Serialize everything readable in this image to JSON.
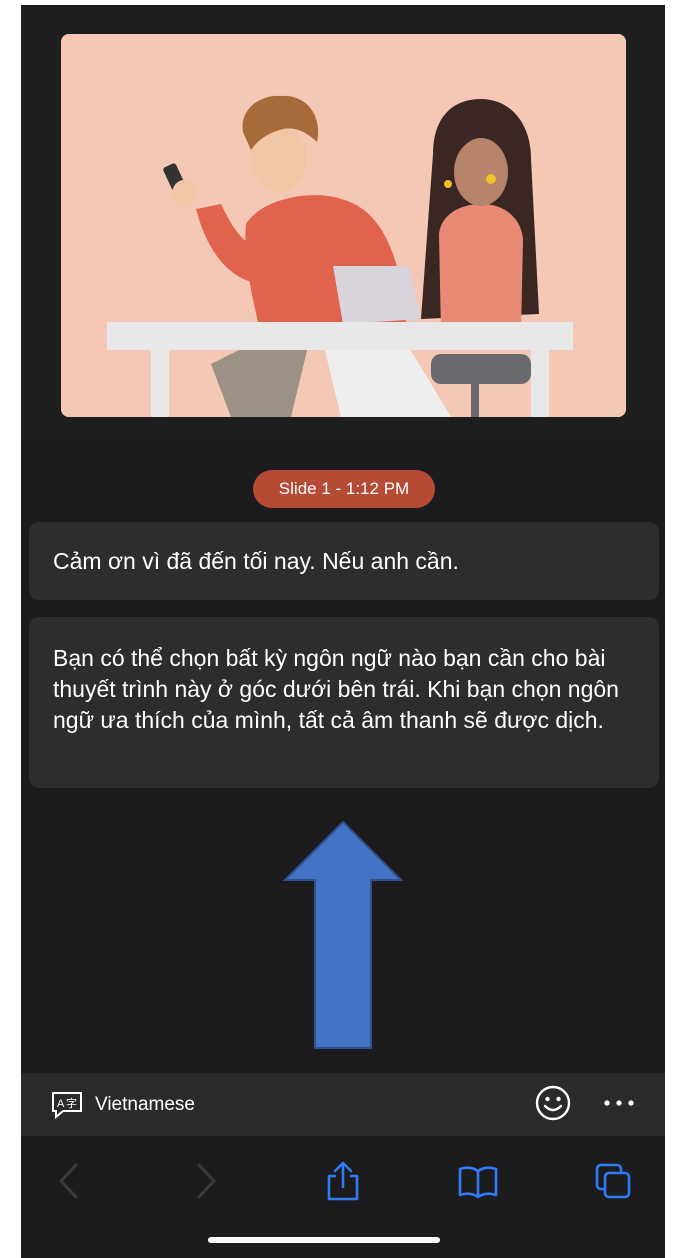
{
  "slide": {
    "image_label": "illustration"
  },
  "timestamp_badge": "Slide 1 - 1:12 PM",
  "captions": [
    {
      "text": "Cảm ơn vì đã đến tối nay. Nếu anh cần."
    },
    {
      "text": "Bạn có thể chọn bất kỳ ngôn ngữ nào bạn cần cho bài thuyết trình này ở góc dưới bên trái. Khi bạn chọn ngôn ngữ ưa thích của mình, tất cả âm thanh sẽ được dịch."
    }
  ],
  "toolbar": {
    "language": "Vietnamese",
    "language_icon": "translate-icon",
    "reaction_icon": "smiley-icon",
    "more_icon": "more-icon"
  },
  "safari": {
    "icons": [
      "back-icon",
      "forward-icon",
      "share-icon",
      "bookmarks-icon",
      "tabs-icon"
    ]
  },
  "colors": {
    "badge": "#b54a35",
    "arrow": "#4472c4",
    "browser_accent": "#2f7cf6"
  }
}
